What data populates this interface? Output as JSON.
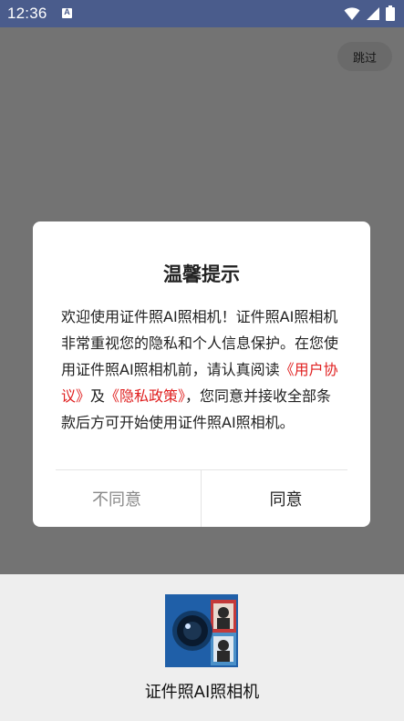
{
  "status_bar": {
    "time": "12:36",
    "notification_icon": "a-box-icon",
    "icons": [
      "wifi-icon",
      "signal-icon",
      "battery-icon"
    ]
  },
  "top_bar": {
    "skip_label": "跳过"
  },
  "splash": {
    "app_name": "证件照AI照相机",
    "logo_icon": "camera-logo-icon"
  },
  "dialog": {
    "title": "温馨提示",
    "body_part1": "欢迎使用证件照AI照相机！证件照AI照相机非常重视您的隐私和个人信息保护。在您使用证件照AI照相机前，请认真阅读",
    "link_user_agreement": "《用户协议》",
    "body_and": "及",
    "link_privacy_policy": "《隐私政策》",
    "body_part2": "，您同意并接收全部条款后方可开始使用证件照AI照相机。",
    "disagree_label": "不同意",
    "agree_label": "同意"
  },
  "colors": {
    "status_bar": "#4a5c8c",
    "link": "#e02020",
    "overlay": "rgba(0,0,0,0.55)",
    "dialog_bg": "#ffffff"
  }
}
